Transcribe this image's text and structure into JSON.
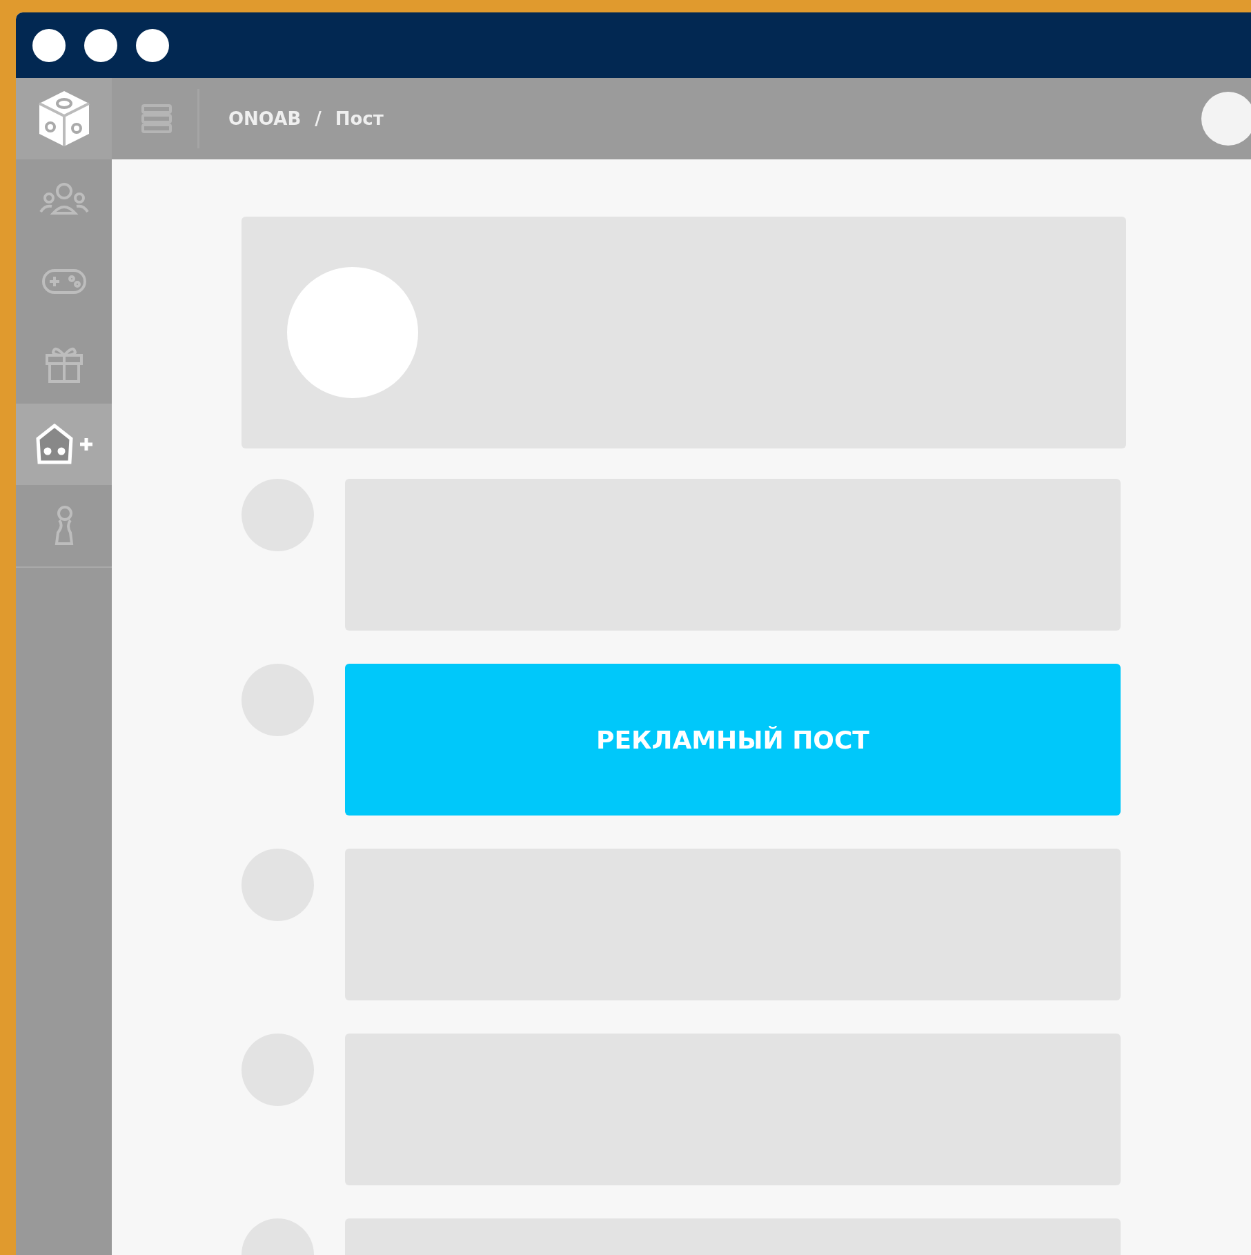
{
  "breadcrumb": [
    {
      "label": "ONOAB"
    },
    {
      "label": "Пост"
    }
  ],
  "breadcrumb_separator": "/",
  "sidebar": {
    "items": [
      {
        "kind": "users",
        "selected": false
      },
      {
        "kind": "gamepad",
        "selected": false
      },
      {
        "kind": "gift",
        "selected": false
      },
      {
        "kind": "meeple",
        "selected": true
      },
      {
        "kind": "pawn",
        "selected": false
      }
    ]
  },
  "posts": [
    {
      "kind": "placeholder"
    },
    {
      "kind": "ad",
      "label": "РЕКЛАМНЫЙ ПОСТ"
    },
    {
      "kind": "placeholder"
    },
    {
      "kind": "placeholder"
    },
    {
      "kind": "placeholder"
    }
  ]
}
